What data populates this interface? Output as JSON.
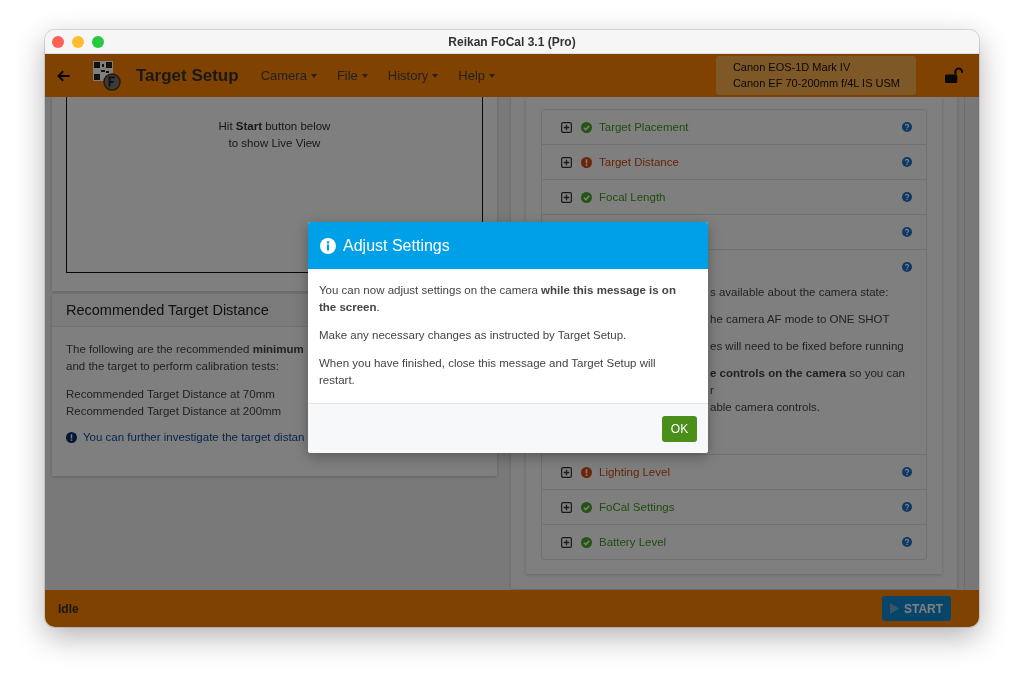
{
  "window": {
    "title": "Reikan FoCal 3.1 (Pro)"
  },
  "header": {
    "title": "Target Setup",
    "menus": [
      "Camera",
      "File",
      "History",
      "Help"
    ],
    "camera": [
      "Canon EOS-1D Mark IV",
      "Canon EF 70-200mm f/4L IS USM"
    ]
  },
  "live_view": {
    "lines": [
      "Hit **Start** button below",
      "to show Live View"
    ]
  },
  "distance_card": {
    "title": "Recommended Target Distance",
    "intro": [
      "The following are the recommended **minimum**",
      "and the target to perform calibration tests:"
    ],
    "distances": [
      "Recommended Target Distance at 70mm",
      "Recommended Target Distance at 200mm"
    ],
    "note": "You can further investigate the target distan"
  },
  "checks": [
    {
      "label": "Target Placement",
      "kind": "ok"
    },
    {
      "label": "Target Distance",
      "kind": "warn"
    },
    {
      "label": "Focal Length",
      "kind": "ok"
    },
    {
      "kind": "covered"
    },
    {
      "kind": "covered",
      "details": [
        {
          "lines": [
            "s available about the camera state:"
          ]
        },
        {
          "lines": [
            "he camera AF mode to ONE SHOT"
          ]
        },
        {
          "lines": [
            "es will need to be fixed before running"
          ]
        },
        {
          "lines": [
            "**e controls on the camera** so you can",
            "r",
            "able camera controls."
          ]
        }
      ]
    },
    {
      "label": "Lighting Level",
      "kind": "warn"
    },
    {
      "label": "FoCal Settings",
      "kind": "ok"
    },
    {
      "label": "Battery Level",
      "kind": "ok"
    }
  ],
  "status_bar": {
    "status": "Idle",
    "button": "START"
  },
  "dialog": {
    "title": "Adjust Settings",
    "paragraphs": [
      "You can now adjust settings on the camera **while this message is on the screen**.",
      "Make any necessary changes as instructed by Target Setup.",
      "When you have finished, close this message and Target Setup will restart."
    ],
    "button": "OK"
  }
}
